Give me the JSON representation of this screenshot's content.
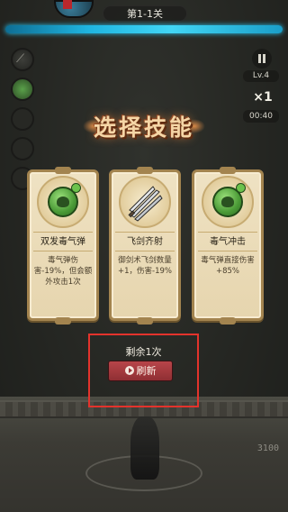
{
  "hud": {
    "stage": "第1-1关",
    "level": "Lv.4",
    "speed": "×1",
    "timer": "00:40",
    "score": "3100"
  },
  "dialog": {
    "title": "选择技能",
    "cards": [
      {
        "name": "双发毒气弹",
        "description": "毒气弹伤害-19%，但会额外攻击1次",
        "icon": "poison-skull-icon"
      },
      {
        "name": "飞剑齐射",
        "description": "御剑术飞剑数量+1，伤害-19%",
        "icon": "flying-swords-icon"
      },
      {
        "name": "毒气冲击",
        "description": "毒气弹直接伤害+85%",
        "icon": "poison-skull-icon"
      }
    ],
    "remaining": "剩余1次",
    "refresh_label": "刷新"
  },
  "colors": {
    "highlight_box": "#e3332c",
    "refresh_button": "#a33b3f",
    "energy_bar": "#29c6ef",
    "card_bg": "#eadbb8",
    "title": "#f5d6a6"
  }
}
